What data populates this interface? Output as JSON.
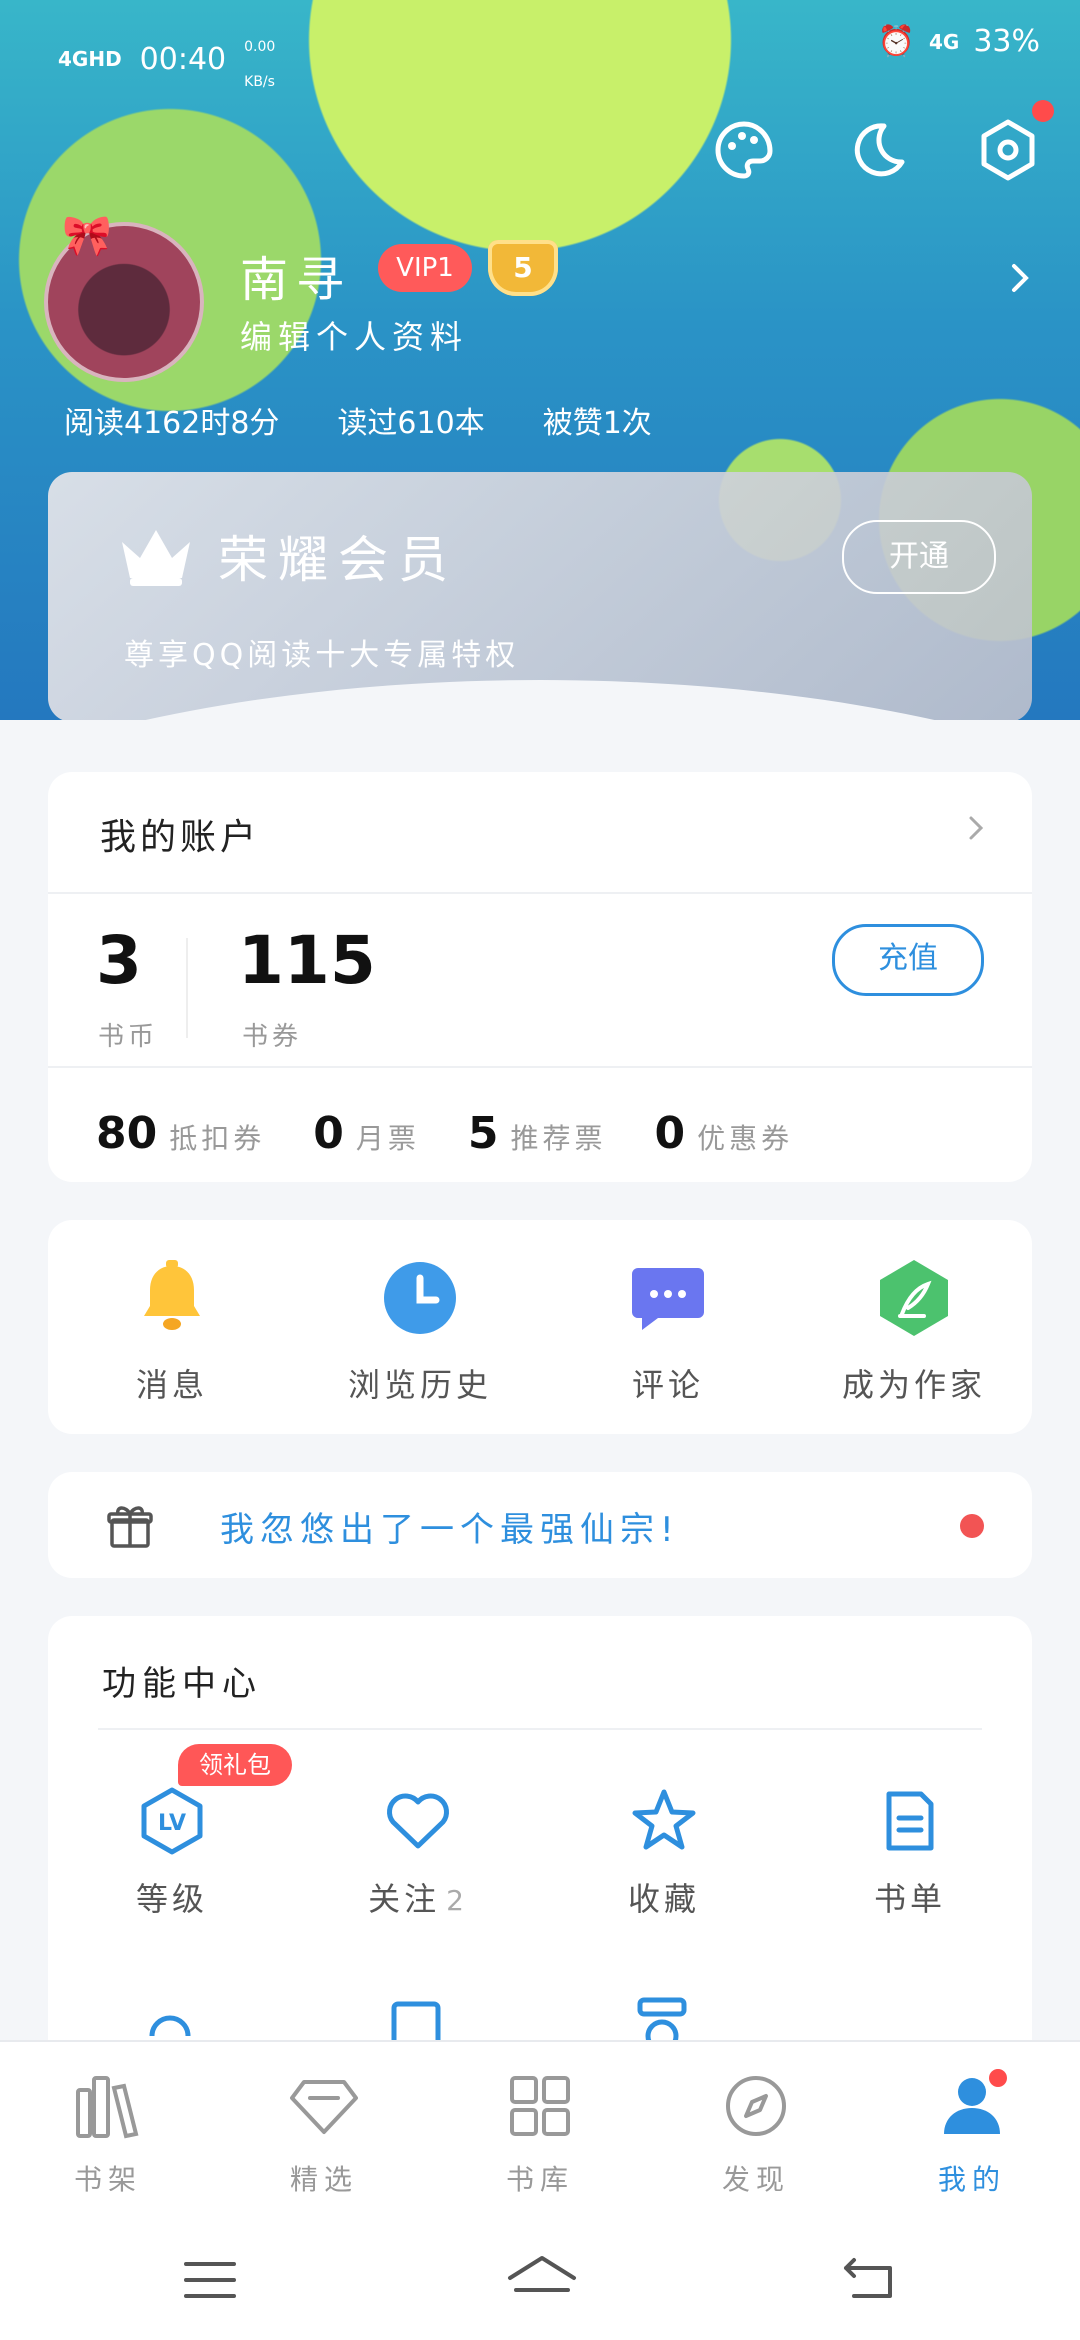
{
  "status_bar": {
    "network": "4GHD",
    "time": "00:40",
    "speed_value": "0.00",
    "speed_unit": "KB/s",
    "right_network": "4G",
    "battery": "33%"
  },
  "profile": {
    "name": "南寻",
    "vip": "VIP1",
    "level": "5",
    "edit": "编辑个人资料",
    "stats": [
      "阅读4162时8分",
      "读过610本",
      "被赞1次"
    ]
  },
  "vip_card": {
    "title": "荣耀会员",
    "desc": "尊享QQ阅读十大专属特权",
    "open": "开通"
  },
  "account": {
    "title": "我的账户",
    "coins": "3",
    "coins_label": "书币",
    "vouchers": "115",
    "vouchers_label": "书券",
    "recharge": "充值",
    "tickets": [
      {
        "n": "80",
        "l": "抵扣券"
      },
      {
        "n": "0",
        "l": "月票"
      },
      {
        "n": "5",
        "l": "推荐票"
      },
      {
        "n": "0",
        "l": "优惠券"
      }
    ]
  },
  "shortcuts": [
    {
      "label": "消息",
      "icon": "bell-icon"
    },
    {
      "label": "浏览历史",
      "icon": "clock-icon"
    },
    {
      "label": "评论",
      "icon": "chat-icon"
    },
    {
      "label": "成为作家",
      "icon": "quill-icon"
    }
  ],
  "promo": {
    "text": "我忽悠出了一个最强仙宗!"
  },
  "functions": {
    "title": "功能中心",
    "gift_tag": "领礼包",
    "items": [
      {
        "label": "等级",
        "icon": "lv-icon"
      },
      {
        "label": "关注",
        "count": "2",
        "icon": "heart-icon"
      },
      {
        "label": "收藏",
        "icon": "star-icon"
      },
      {
        "label": "书单",
        "icon": "booklist-icon"
      }
    ]
  },
  "bottom_nav": [
    {
      "label": "书架",
      "icon": "bookshelf-icon"
    },
    {
      "label": "精选",
      "icon": "diamond-icon"
    },
    {
      "label": "书库",
      "icon": "grid-icon"
    },
    {
      "label": "发现",
      "icon": "compass-icon"
    },
    {
      "label": "我的",
      "icon": "user-icon",
      "active": true
    }
  ],
  "colors": {
    "accent": "#2e8fde",
    "badge_red": "#ff5757"
  }
}
